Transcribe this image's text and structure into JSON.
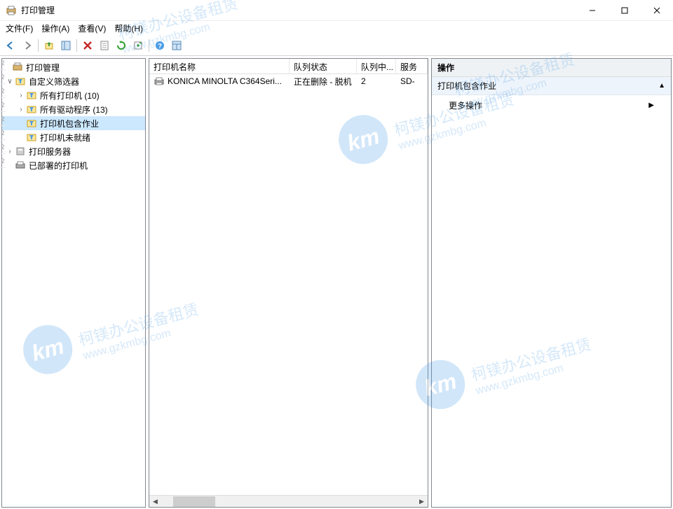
{
  "window": {
    "title": "打印管理"
  },
  "menus": {
    "file": "文件(F)",
    "action": "操作(A)",
    "view": "查看(V)",
    "help": "帮助(H)"
  },
  "tree": {
    "root": "打印管理",
    "custom_filters": "自定义筛选器",
    "all_printers": "所有打印机 (10)",
    "all_drivers": "所有驱动程序 (13)",
    "printers_with_jobs": "打印机包含作业",
    "printers_not_ready": "打印机未就绪",
    "print_servers": "打印服务器",
    "deployed_printers": "已部署的打印机"
  },
  "list": {
    "columns": {
      "name": "打印机名称",
      "queue_status": "队列状态",
      "queue_count": "队列中...",
      "server": "服务"
    },
    "rows": [
      {
        "name": "KONICA MINOLTA C364Seri...",
        "queue_status": "正在删除 - 脱机",
        "queue_count": "2",
        "server": "SD-"
      }
    ]
  },
  "actions": {
    "header": "操作",
    "group": "打印机包含作业",
    "more": "更多操作"
  },
  "watermark": {
    "logo_text": "km",
    "cn": "柯镁办公设备租赁",
    "url": "www.gzkmbg.com"
  }
}
